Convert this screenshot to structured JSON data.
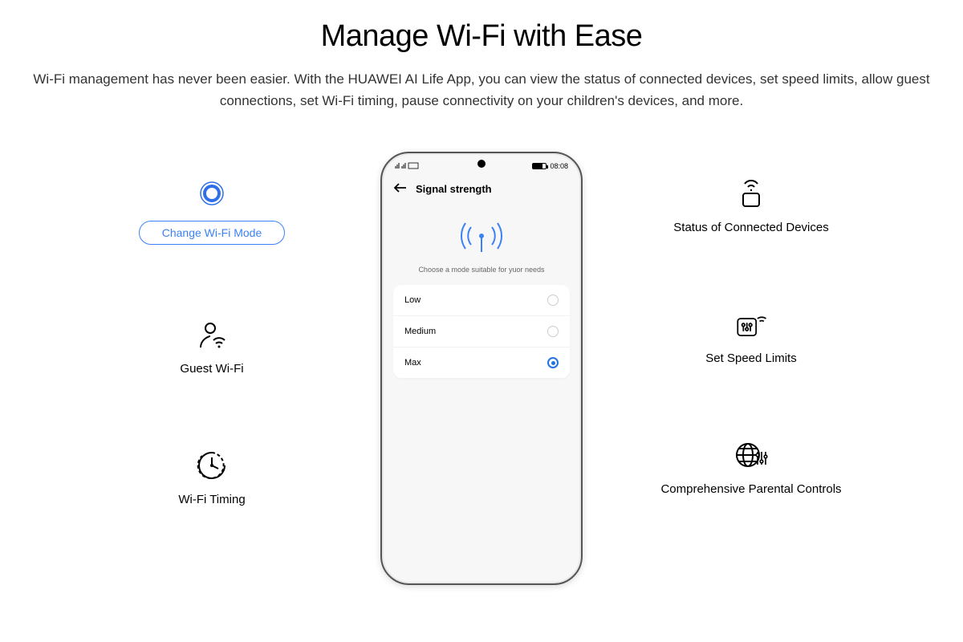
{
  "heading": "Manage Wi-Fi with Ease",
  "subheading": "Wi-Fi management has never been easier. With the HUAWEI AI Life App, you can view the status of connected devices, set speed limits, allow guest connections, set Wi-Fi timing, pause connectivity on your children's devices, and more.",
  "left": {
    "feature1_label": "Change Wi-Fi Mode",
    "feature2_label": "Guest Wi-Fi",
    "feature3_label": "Wi-Fi Timing"
  },
  "right": {
    "feature1_label": "Status of Connected Devices",
    "feature2_label": "Set Speed Limits",
    "feature3_label": "Comprehensive Parental Controls"
  },
  "phone": {
    "time": "08:08",
    "screen_title": "Signal strength",
    "prompt": "Choose a mode suitable for yuor needs",
    "options": {
      "opt1": "Low",
      "opt2": "Medium",
      "opt3": "Max"
    }
  }
}
